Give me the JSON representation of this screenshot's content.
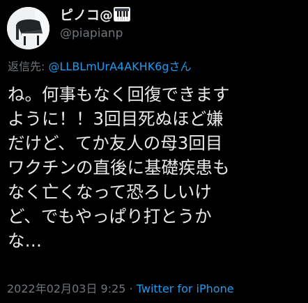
{
  "author": {
    "display_name": "ピノコ@",
    "display_name_emoji": "piano-keyboard",
    "handle": "@piapianp",
    "avatar": "grand-piano-photo"
  },
  "reply": {
    "prefix": "返信先:",
    "mention": "@LLBLmUrA4AKHK6gさん"
  },
  "tweet": {
    "lines": [
      "ね。何事もなく回復できます",
      "ように！！3回目死ぬほど嫌",
      "だけど、てか友人の母3回目",
      "ワクチンの直後に基礎疾患も",
      "なく亡くなって恐ろしいけ",
      "ど、でもやっぱり打とうか",
      "な…"
    ]
  },
  "meta": {
    "timestamp": "2022年02月03日 9:25",
    "separator": "·",
    "source": "Twitter for iPhone"
  },
  "colors": {
    "background": "#000000",
    "text": "#e7e9ea",
    "muted": "#71767b",
    "link": "#1d9bf0"
  }
}
